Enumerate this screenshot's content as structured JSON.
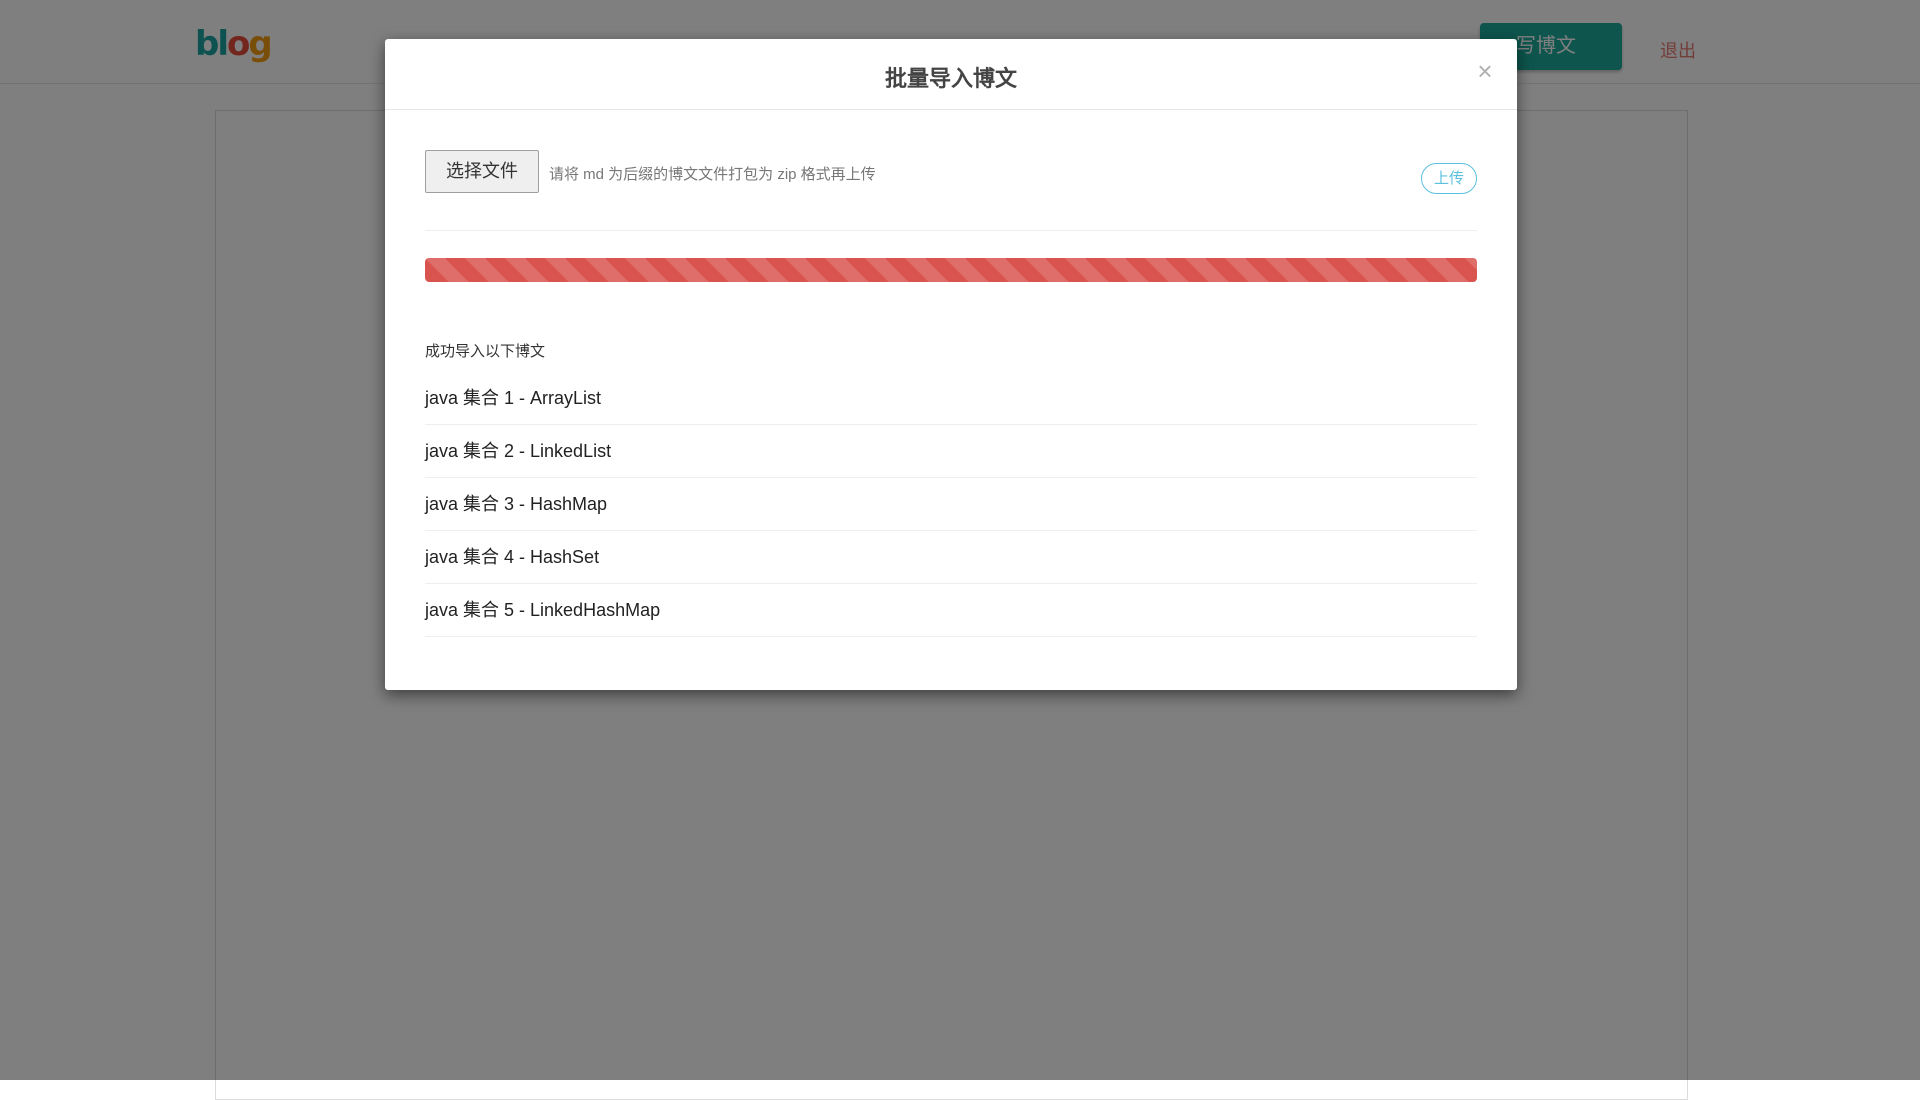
{
  "header": {
    "logo": {
      "part1": "bl",
      "part2": "o",
      "part3": "g"
    },
    "nav_hint": "·   ·  ·· ··",
    "write_button": "写博文",
    "logout": "退出"
  },
  "modal": {
    "title": "批量导入博文",
    "close_symbol": "×",
    "choose_file_label": "选择文件",
    "upload_hint": "请将 md 为后缀的博文文件打包为 zip 格式再上传",
    "upload_button": "上传",
    "progress": {
      "percent": 100,
      "color": "#d9534f",
      "striped": true
    },
    "success_label": "成功导入以下博文",
    "posts": [
      "java 集合 1 - ArrayList",
      "java 集合 2 - LinkedList",
      "java 集合 3 - HashMap",
      "java 集合 4 - HashSet",
      "java 集合 5 - LinkedHashMap"
    ]
  },
  "colors": {
    "accent": "#1aaa9a",
    "danger": "#d9534f",
    "info": "#5bc0de",
    "logout": "#e77b72"
  }
}
